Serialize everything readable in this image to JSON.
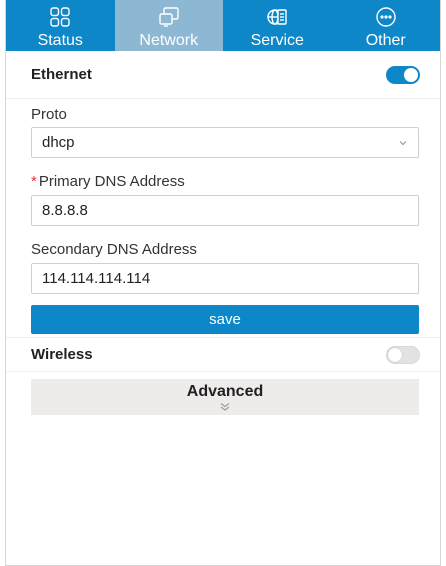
{
  "nav": {
    "items": [
      {
        "label": "Status",
        "icon": "grid-icon",
        "active": false
      },
      {
        "label": "Network",
        "icon": "windows-icon",
        "active": true
      },
      {
        "label": "Service",
        "icon": "globe-doc-icon",
        "active": false
      },
      {
        "label": "Other",
        "icon": "more-circle-icon",
        "active": false
      }
    ]
  },
  "ethernet": {
    "title": "Ethernet",
    "enabled": true,
    "proto": {
      "label": "Proto",
      "value": "dhcp"
    },
    "primary_dns": {
      "label": "Primary DNS Address",
      "required_mark": "*",
      "value": "8.8.8.8"
    },
    "secondary_dns": {
      "label": "Secondary DNS Address",
      "value": "114.114.114.114"
    },
    "save_label": "save"
  },
  "wireless": {
    "title": "Wireless",
    "enabled": false
  },
  "advanced": {
    "label": "Advanced",
    "icon": "double-chevron-down-icon"
  },
  "colors": {
    "brand": "#0d87c8",
    "nav_active": "#8db8d4",
    "required": "#e33333"
  }
}
